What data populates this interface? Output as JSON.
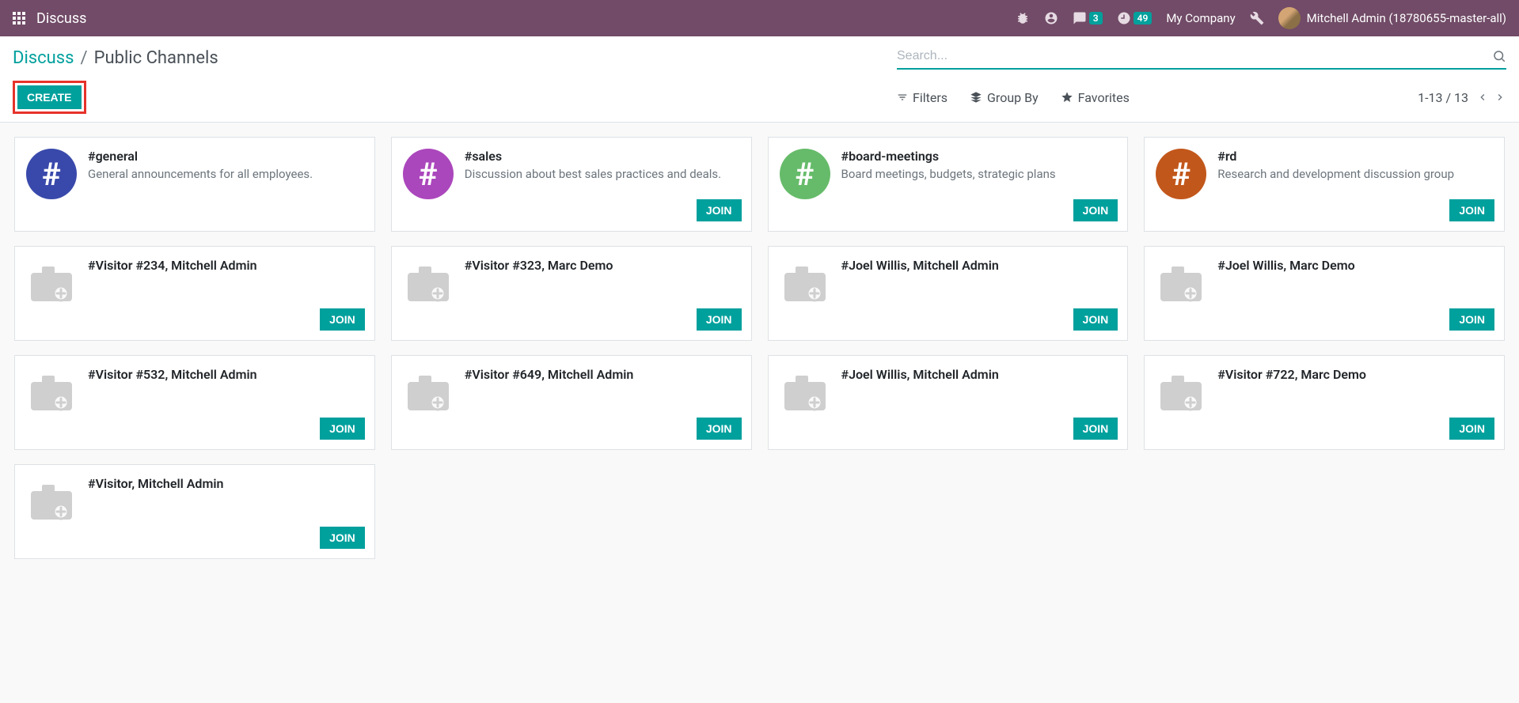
{
  "navbar": {
    "title": "Discuss",
    "company": "My Company",
    "user": "Mitchell Admin (18780655-master-all)",
    "messages_badge": "3",
    "activities_badge": "49"
  },
  "breadcrumb": {
    "root": "Discuss",
    "sep": "/",
    "current": "Public Channels"
  },
  "search": {
    "placeholder": "Search..."
  },
  "buttons": {
    "create": "CREATE",
    "join": "JOIN",
    "filters": "Filters",
    "group_by": "Group By",
    "favorites": "Favorites"
  },
  "pager": {
    "text": "1-13 / 13"
  },
  "channels": [
    {
      "name": "#general",
      "desc": "General announcements for all employees.",
      "color": "#3949ab",
      "hash": true,
      "join": false
    },
    {
      "name": "#sales",
      "desc": "Discussion about best sales practices and deals.",
      "color": "#ab47bc",
      "hash": true,
      "join": true
    },
    {
      "name": "#board-meetings",
      "desc": "Board meetings, budgets, strategic plans",
      "color": "#66bb6a",
      "hash": true,
      "join": true
    },
    {
      "name": "#rd",
      "desc": "Research and development discussion group",
      "color": "#c2571b",
      "hash": true,
      "join": true
    },
    {
      "name": "#Visitor #234, Mitchell Admin",
      "desc": "",
      "hash": false,
      "join": true
    },
    {
      "name": "#Visitor #323, Marc Demo",
      "desc": "",
      "hash": false,
      "join": true
    },
    {
      "name": "#Joel Willis, Mitchell Admin",
      "desc": "",
      "hash": false,
      "join": true
    },
    {
      "name": "#Joel Willis, Marc Demo",
      "desc": "",
      "hash": false,
      "join": true
    },
    {
      "name": "#Visitor #532, Mitchell Admin",
      "desc": "",
      "hash": false,
      "join": true
    },
    {
      "name": "#Visitor #649, Mitchell Admin",
      "desc": "",
      "hash": false,
      "join": true
    },
    {
      "name": "#Joel Willis, Mitchell Admin",
      "desc": "",
      "hash": false,
      "join": true
    },
    {
      "name": "#Visitor #722, Marc Demo",
      "desc": "",
      "hash": false,
      "join": true
    },
    {
      "name": "#Visitor, Mitchell Admin",
      "desc": "",
      "hash": false,
      "join": true
    }
  ]
}
